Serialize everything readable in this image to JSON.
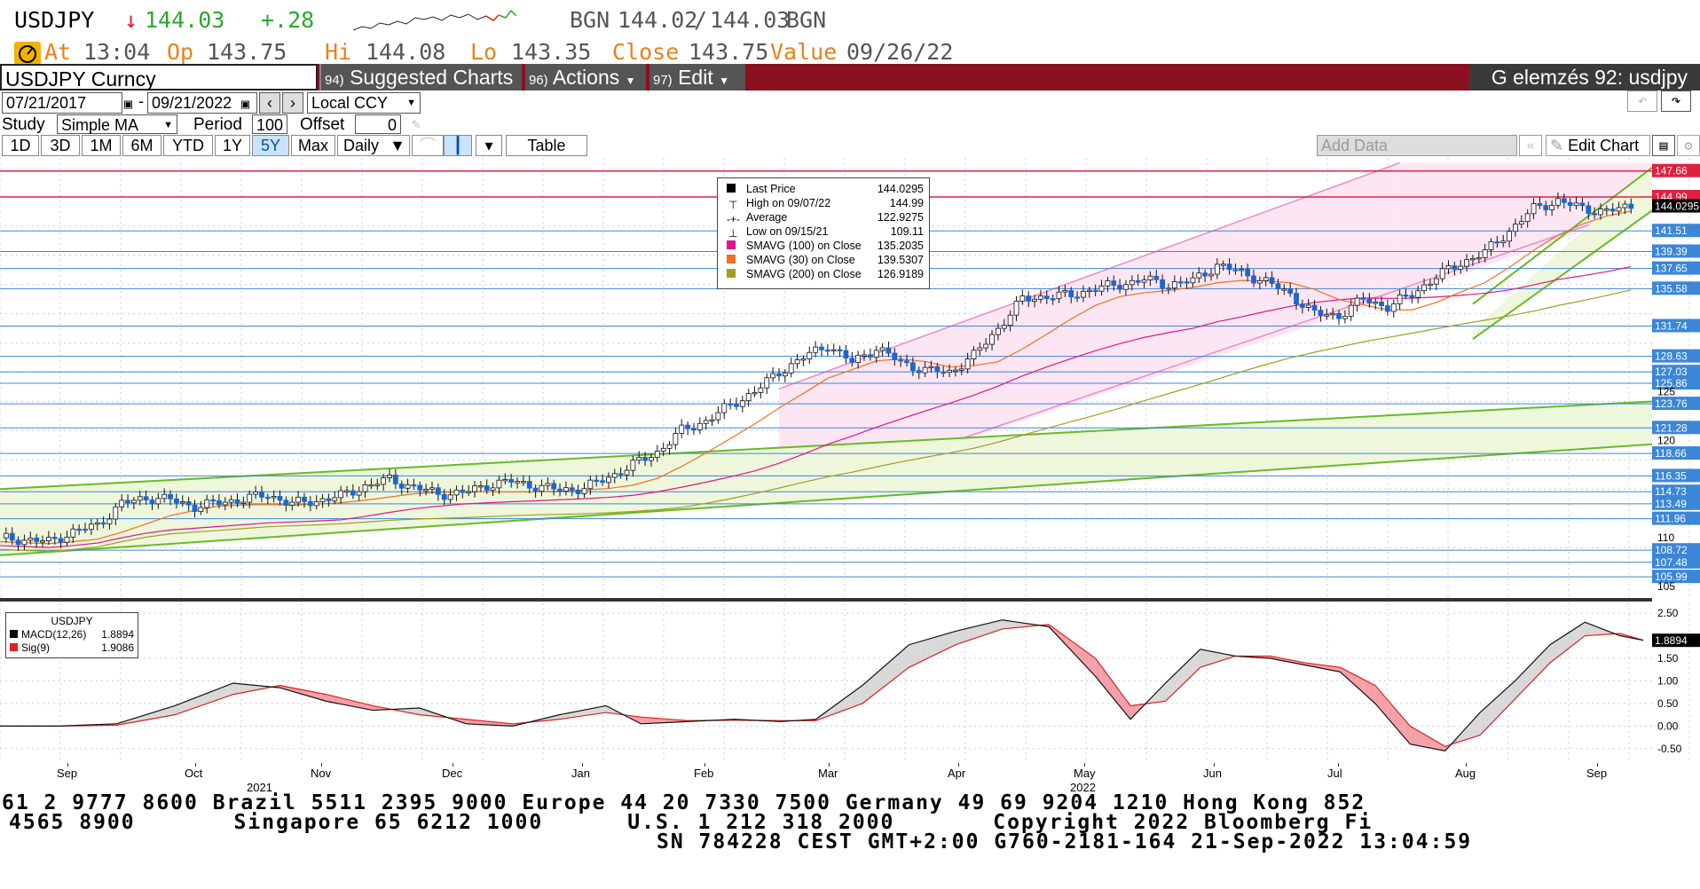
{
  "quote": {
    "ticker": "USDJPY",
    "arrow": "↓",
    "last": "144.03",
    "change": "+.28",
    "bid_src": "BGN",
    "bid": "144.02",
    "sep": "/",
    "ask": "144.03",
    "ask_src": "BGN",
    "at_label": "At",
    "at_time": "13:04",
    "op_label": "Op",
    "op": "143.75",
    "hi_label": "Hi",
    "hi": "144.08",
    "lo_label": "Lo",
    "lo": "143.35",
    "close_label": "Close",
    "close": "143.75",
    "value_label": "Value",
    "value_date": "09/26/22"
  },
  "toolbar": {
    "security": "USDJPY Curncy",
    "suggested_num": "94)",
    "suggested": "Suggested Charts",
    "actions_num": "96)",
    "actions": "Actions",
    "edit_num": "97)",
    "edit": "Edit",
    "title": "G elemzés 92: usdjpy"
  },
  "controls": {
    "start_date": "07/21/2017",
    "dash": "-",
    "end_date": "09/21/2022",
    "currency": "Local CCY",
    "study_label": "Study",
    "study": "Simple MA",
    "period_label": "Period",
    "period": "100",
    "offset_label": "Offset",
    "offset": "0",
    "tabs": [
      "1D",
      "3D",
      "1M",
      "6M",
      "YTD",
      "1Y",
      "5Y",
      "Max"
    ],
    "selected_tab": "5Y",
    "frequency": "Daily",
    "table_label": "Table",
    "add_data_placeholder": "Add Data",
    "edit_chart": "Edit Chart"
  },
  "legend": {
    "last_price_label": "Last Price",
    "last_price": "144.0295",
    "high_label": "High on 09/07/22",
    "high": "144.99",
    "avg_label": "Average",
    "avg": "122.9275",
    "low_label": "Low on 09/15/21",
    "low": "109.11",
    "sma100_label": "SMAVG (100)  on Close",
    "sma100": "135.2035",
    "sma30_label": "SMAVG (30)  on Close",
    "sma30": "139.5307",
    "sma200_label": "SMAVG (200)  on Close",
    "sma200": "126.9189"
  },
  "macd_legend": {
    "title": "USDJPY",
    "macd_label": "MACD(12,26)",
    "macd": "1.8894",
    "sig_label": "Sig(9)",
    "sig": "1.9086"
  },
  "colors": {
    "price_up": "#1a66d6",
    "sma100": "#e0148c",
    "sma30": "#f07020",
    "sma200": "#a0a020",
    "channel_pink": "#ee88c8",
    "channel_green": "#66bb22",
    "hline_blue": "#3b86d8",
    "hline_red": "#e02040",
    "toolbar_red": "#8b1020",
    "quote_green": "#2ea62e",
    "quote_orange": "#e8821a"
  },
  "chart_data": [
    {
      "type": "candlestick",
      "y_axis_right_tags": [
        "147.66",
        "144.99",
        "144.0295",
        "141.51",
        "139.39",
        "137.65",
        "135.58",
        "131.74",
        "128.63",
        "127.03",
        "125.86",
        "123.76",
        "121.28",
        "118.66",
        "116.35",
        "114.73",
        "113.49",
        "111.96",
        "108.72",
        "107.48",
        "105.99"
      ],
      "y_axis_ticks": [
        "125",
        "120",
        "110",
        "105"
      ],
      "ylim": [
        104,
        149
      ],
      "x_labels": [
        "Sep",
        "Oct",
        "Nov",
        "Dec",
        "Jan",
        "Feb",
        "Mar",
        "Apr",
        "May",
        "Jun",
        "Jul",
        "Aug",
        "Sep"
      ],
      "x_year_labels": [
        "2021",
        "2022"
      ],
      "horizontal_levels_blue": [
        141.51,
        139.39,
        137.65,
        135.58,
        131.74,
        128.63,
        127.03,
        125.86,
        123.76,
        121.28,
        118.66,
        116.35,
        114.73,
        113.49,
        111.96,
        108.72,
        107.48,
        105.99
      ],
      "horizontal_levels_red": [
        147.66,
        144.99
      ],
      "price_path": [
        [
          0,
          110.0
        ],
        [
          4,
          109.8
        ],
        [
          8,
          109.6
        ],
        [
          12,
          110.6
        ],
        [
          16,
          111.3
        ],
        [
          20,
          113.5
        ],
        [
          24,
          114.1
        ],
        [
          28,
          113.9
        ],
        [
          32,
          113.2
        ],
        [
          36,
          113.6
        ],
        [
          40,
          114.0
        ],
        [
          44,
          114.4
        ],
        [
          48,
          113.5
        ],
        [
          52,
          113.8
        ],
        [
          56,
          114.3
        ],
        [
          60,
          115.3
        ],
        [
          64,
          116.0
        ],
        [
          68,
          115.2
        ],
        [
          72,
          114.5
        ],
        [
          76,
          114.6
        ],
        [
          80,
          115.4
        ],
        [
          84,
          115.8
        ],
        [
          88,
          115.3
        ],
        [
          92,
          114.9
        ],
        [
          96,
          115.1
        ],
        [
          100,
          116.2
        ],
        [
          104,
          117.5
        ],
        [
          108,
          118.8
        ],
        [
          112,
          121.0
        ],
        [
          116,
          122.0
        ],
        [
          120,
          123.6
        ],
        [
          124,
          125.0
        ],
        [
          128,
          127.0
        ],
        [
          132,
          128.5
        ],
        [
          136,
          129.8
        ],
        [
          140,
          128.0
        ],
        [
          144,
          129.5
        ],
        [
          148,
          128.0
        ],
        [
          152,
          127.2
        ],
        [
          156,
          127.0
        ],
        [
          160,
          128.7
        ],
        [
          164,
          131.5
        ],
        [
          168,
          134.5
        ],
        [
          172,
          134.8
        ],
        [
          176,
          134.9
        ],
        [
          180,
          135.6
        ],
        [
          184,
          136.0
        ],
        [
          188,
          136.5
        ],
        [
          192,
          136.0
        ],
        [
          196,
          136.4
        ],
        [
          200,
          138.0
        ],
        [
          204,
          137.2
        ],
        [
          208,
          136.3
        ],
        [
          212,
          135.0
        ],
        [
          216,
          133.0
        ],
        [
          220,
          132.8
        ],
        [
          224,
          134.5
        ],
        [
          228,
          133.7
        ],
        [
          232,
          135.0
        ],
        [
          236,
          136.8
        ],
        [
          240,
          138.2
        ],
        [
          244,
          139.3
        ],
        [
          248,
          141.5
        ],
        [
          252,
          143.8
        ],
        [
          256,
          144.6
        ],
        [
          260,
          143.8
        ],
        [
          264,
          143.5
        ],
        [
          268,
          144.03
        ]
      ]
    },
    {
      "type": "line",
      "name": "MACD",
      "ylim": [
        -0.7,
        2.6
      ],
      "y_ticks": [
        "2.50",
        "1.50",
        "1.00",
        "0.50",
        "0.00",
        "-0.50"
      ],
      "y_tag": "1.8894",
      "macd_path": [
        [
          0,
          0.0
        ],
        [
          10,
          0.0
        ],
        [
          20,
          0.05
        ],
        [
          30,
          0.45
        ],
        [
          40,
          0.95
        ],
        [
          48,
          0.85
        ],
        [
          56,
          0.55
        ],
        [
          64,
          0.35
        ],
        [
          72,
          0.4
        ],
        [
          80,
          0.05
        ],
        [
          88,
          0.0
        ],
        [
          96,
          0.25
        ],
        [
          104,
          0.45
        ],
        [
          110,
          0.05
        ],
        [
          118,
          0.1
        ],
        [
          126,
          0.15
        ],
        [
          134,
          0.1
        ],
        [
          140,
          0.15
        ],
        [
          148,
          0.9
        ],
        [
          156,
          1.8
        ],
        [
          164,
          2.1
        ],
        [
          172,
          2.35
        ],
        [
          180,
          2.2
        ],
        [
          188,
          1.1
        ],
        [
          194,
          0.15
        ],
        [
          200,
          0.95
        ],
        [
          206,
          1.7
        ],
        [
          212,
          1.55
        ],
        [
          218,
          1.5
        ],
        [
          224,
          1.35
        ],
        [
          230,
          1.2
        ],
        [
          236,
          0.5
        ],
        [
          242,
          -0.4
        ],
        [
          248,
          -0.55
        ],
        [
          254,
          0.3
        ],
        [
          260,
          1.0
        ],
        [
          266,
          1.8
        ],
        [
          272,
          2.3
        ],
        [
          278,
          2.0
        ],
        [
          282,
          1.9
        ]
      ],
      "sig_path": [
        [
          0,
          0.0
        ],
        [
          10,
          0.0
        ],
        [
          20,
          0.02
        ],
        [
          30,
          0.25
        ],
        [
          40,
          0.7
        ],
        [
          48,
          0.9
        ],
        [
          56,
          0.7
        ],
        [
          64,
          0.45
        ],
        [
          72,
          0.25
        ],
        [
          80,
          0.15
        ],
        [
          88,
          0.05
        ],
        [
          96,
          0.15
        ],
        [
          104,
          0.3
        ],
        [
          110,
          0.2
        ],
        [
          118,
          0.12
        ],
        [
          126,
          0.13
        ],
        [
          134,
          0.12
        ],
        [
          140,
          0.12
        ],
        [
          148,
          0.5
        ],
        [
          156,
          1.3
        ],
        [
          164,
          1.8
        ],
        [
          172,
          2.15
        ],
        [
          180,
          2.25
        ],
        [
          188,
          1.5
        ],
        [
          194,
          0.45
        ],
        [
          200,
          0.55
        ],
        [
          206,
          1.3
        ],
        [
          212,
          1.55
        ],
        [
          218,
          1.55
        ],
        [
          224,
          1.4
        ],
        [
          230,
          1.3
        ],
        [
          236,
          0.9
        ],
        [
          242,
          0.0
        ],
        [
          248,
          -0.45
        ],
        [
          254,
          -0.2
        ],
        [
          260,
          0.6
        ],
        [
          266,
          1.4
        ],
        [
          272,
          2.0
        ],
        [
          278,
          2.05
        ],
        [
          282,
          1.9
        ]
      ]
    }
  ],
  "footer": {
    "line1": "61 2 9777 8600 Brazil 5511 2395 9000 Europe 44 20 7330 7500 Germany 49 69 9204 1210 Hong Kong 852",
    "line2": "4565 8900       Singapore 65 6212 1000      U.S. 1 212 318 2000       Copyright 2022 Bloomberg Fi",
    "line3": "SN 784228 CEST GMT+2:00 G760-2181-164 21-Sep-2022 13:04:59"
  }
}
